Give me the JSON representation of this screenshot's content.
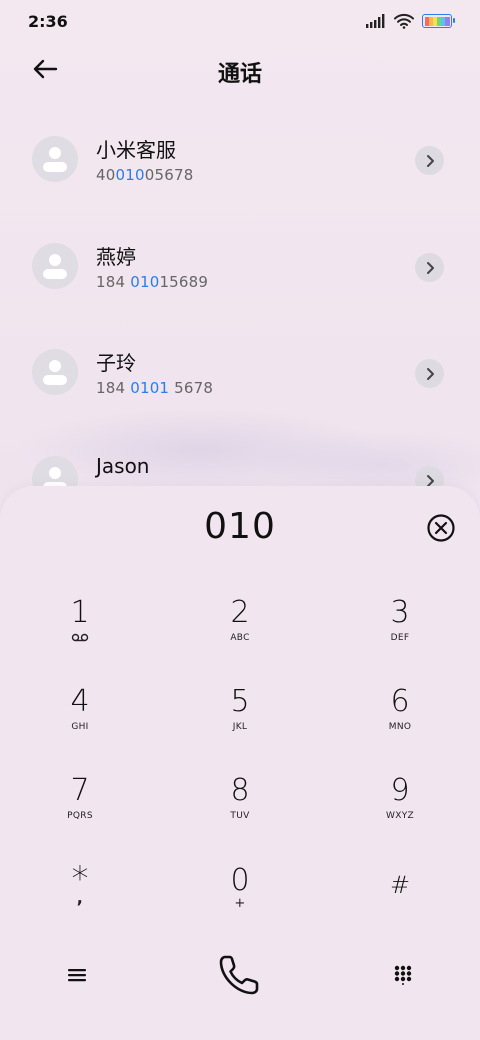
{
  "status_bar": {
    "time": "2:36"
  },
  "header": {
    "title": "通话"
  },
  "contacts": [
    {
      "name": "小米客服",
      "number_parts": [
        "40",
        "010",
        "05678"
      ]
    },
    {
      "name": "燕婷",
      "number_parts": [
        "184 ",
        "010",
        "15689"
      ]
    },
    {
      "name": "子玲",
      "number_parts": [
        "184 ",
        "0101",
        " 5678"
      ]
    },
    {
      "name": "Jason",
      "number_parts": [
        "",
        "",
        ""
      ]
    }
  ],
  "dialer": {
    "input_value": "010",
    "keys": [
      {
        "digit": "1",
        "letters": ""
      },
      {
        "digit": "2",
        "letters": "ABC"
      },
      {
        "digit": "3",
        "letters": "DEF"
      },
      {
        "digit": "4",
        "letters": "GHI"
      },
      {
        "digit": "5",
        "letters": "JKL"
      },
      {
        "digit": "6",
        "letters": "MNO"
      },
      {
        "digit": "7",
        "letters": "PQRS"
      },
      {
        "digit": "8",
        "letters": "TUV"
      },
      {
        "digit": "9",
        "letters": "WXYZ"
      },
      {
        "digit": "*",
        "letters": ","
      },
      {
        "digit": "0",
        "letters": "+"
      },
      {
        "digit": "#",
        "letters": ""
      }
    ]
  },
  "icons": {
    "back": "arrow-left-icon",
    "chevron": "chevron-right-icon",
    "clear": "clear-circle-x-icon",
    "voicemail": "voicemail-icon",
    "menu": "menu-icon",
    "call": "phone-icon",
    "keypad": "keypad-icon"
  },
  "colors": {
    "background": "#f1e6ef",
    "highlight": "#2b7de9",
    "avatar_bg": "#dfdde3"
  }
}
